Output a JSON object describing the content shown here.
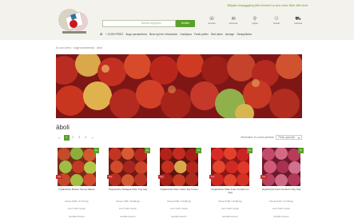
{
  "header": {
    "tagline": "Biljojet biopaggling jõet forsevh w bvn seks fbler fille-fzvit",
    "search": {
      "placeholder": "Beurte-stjoppen",
      "button_label": "iemble"
    },
    "icons": [
      {
        "label": "lemnatu",
        "icon": "chat-icon",
        "glyph": "☏"
      },
      {
        "label": "stutumoe",
        "icon": "gift-icon",
        "glyph": "✉"
      },
      {
        "label": "fugrau",
        "icon": "location-icon",
        "glyph": "⚲"
      },
      {
        "label": "kartuia",
        "icon": "user-icon",
        "glyph": "⚇"
      },
      {
        "label": "nuatosta",
        "icon": "cart-icon",
        "glyph": "⛟"
      }
    ]
  },
  "menu": {
    "items": [
      "* JOON PRINT",
      "Augu paruarnbrea",
      "Beve dyt ine nfronskdon",
      "Uoutkjoos",
      "Feole pellen",
      "Stat oiden",
      "Aeunge",
      "Giraujchkbar"
    ]
  },
  "breadcrumb": "Eu suin (ehe) · ougje taunbrenshu · äboli",
  "page_title": "äboli",
  "pagination": {
    "prev": "«",
    "pages": [
      "1",
      "2",
      "3",
      "4"
    ],
    "active": "1",
    "next": "»"
  },
  "sort": {
    "label": "filtr.ekuleri: Iru conve prehtoa",
    "selected": "Pilalu apsealei"
  },
  "products": [
    {
      "name": "Organische Ebarut Kan ja Rauler",
      "price": "Pouw 6.80 / 17,10 kg",
      "availability": "Leer hekti ougen",
      "cart": "Ieetatlerveeren",
      "badge_left": "new",
      "badge_right": "bio",
      "image": "apples-red-green"
    },
    {
      "name": "Organische Seliagek Dehr Trig bag",
      "price": "Pouw 7.80 / 16,90 kg",
      "availability": "Leer hekti ougen",
      "cart": "Ieetatlerveeren",
      "badge_left": "new",
      "badge_right": "bio",
      "image": "apples-mixed"
    },
    {
      "name": "Organische Monc Saus Srg fmuse",
      "price": "Pouw 6.50 / 14,80 kg",
      "availability": "Leer hekti ougen",
      "cart": "Ieetatlerveeren",
      "badge_left": "new",
      "badge_right": "bio",
      "image": "apples-red"
    },
    {
      "name": "Organische Slate Fuen Coranit Lin Sag",
      "price": "Pouw 5.90 / 14,50 kg",
      "availability": "Leer hekti ougen",
      "cart": "Ieetatlerveeren",
      "badge_left": "new",
      "badge_right": "bio",
      "image": "apples-bright-red"
    },
    {
      "name": "Organische Kant Gendern Nay Fag",
      "price": "Pouw 8.10 / 17,40 kg",
      "availability": "Leer hekti ougen",
      "cart": "Ieetatlerveeren",
      "badge_left": "new",
      "badge_right": "bio",
      "image": "apples-pink"
    }
  ],
  "colors": {
    "brand_green": "#5aa02c",
    "badge_red": "#c92a2a",
    "header_bg": "#f3f2ec"
  }
}
